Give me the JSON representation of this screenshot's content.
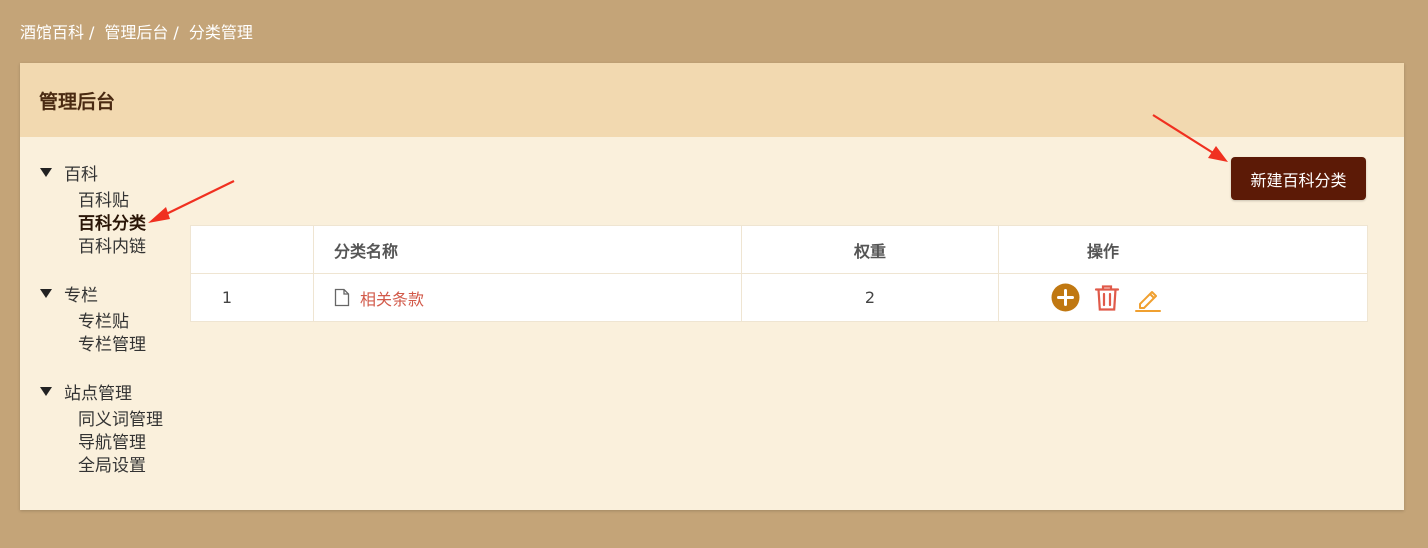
{
  "breadcrumb": {
    "items": [
      "酒馆百科",
      "管理后台",
      "分类管理"
    ],
    "separator": "/"
  },
  "panel": {
    "title": "管理后台"
  },
  "sidebar": {
    "groups": [
      {
        "label": "百科",
        "items": [
          {
            "label": "百科贴"
          },
          {
            "label": "百科分类",
            "active": true
          },
          {
            "label": "百科内链"
          }
        ]
      },
      {
        "label": "专栏",
        "items": [
          {
            "label": "专栏贴"
          },
          {
            "label": "专栏管理"
          }
        ]
      },
      {
        "label": "站点管理",
        "items": [
          {
            "label": "同义词管理"
          },
          {
            "label": "导航管理"
          },
          {
            "label": "全局设置"
          }
        ]
      }
    ]
  },
  "toolbar": {
    "new_button": "新建百科分类"
  },
  "table": {
    "headers": [
      "",
      "分类名称",
      "权重",
      "操作"
    ],
    "rows": [
      {
        "index": "1",
        "name": "相关条款",
        "weight": "2"
      }
    ]
  },
  "icons": {
    "add": "plus-circle-icon",
    "delete": "trash-icon",
    "edit": "pencil-icon",
    "file": "file-icon"
  },
  "colors": {
    "page_bg": "#c4a478",
    "panel_bg": "#faf0dc",
    "header_bg": "#f2d9b0",
    "button_bg": "#5c1a06",
    "link": "#d25a4a",
    "add_icon": "#c07812",
    "delete_icon": "#e05a4a",
    "edit_icon": "#f0a030",
    "annotation_arrow": "#f03020"
  }
}
